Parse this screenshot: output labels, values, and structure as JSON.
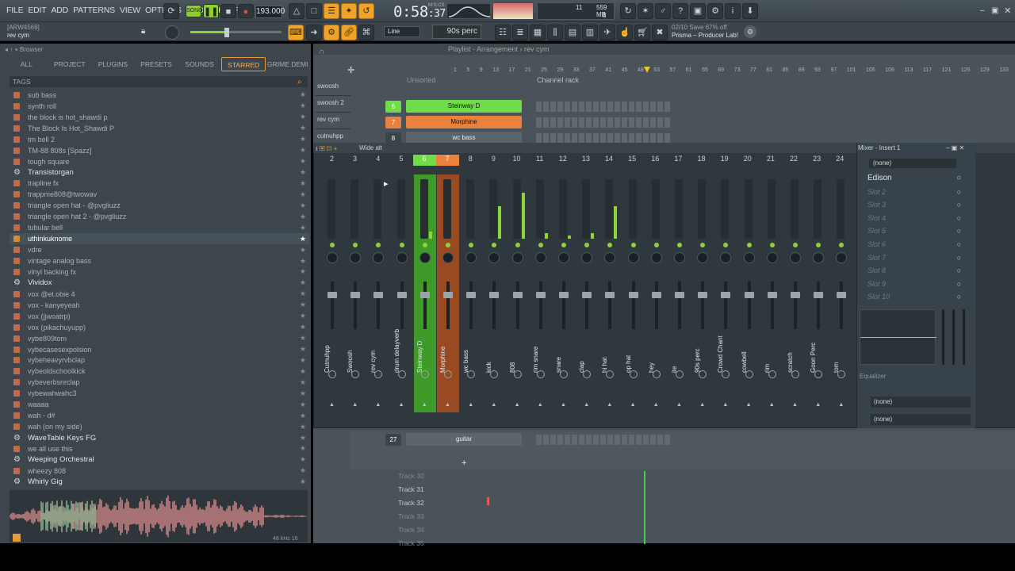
{
  "menu": [
    "FILE",
    "EDIT",
    "ADD",
    "PATTERNS",
    "VIEW",
    "OPTIONS",
    "TOOLS",
    "HELP"
  ],
  "transport": {
    "tempo": "193.000",
    "time_main": "0:58",
    "time_sub": ":37",
    "time_unit": "M:S:CS",
    "mode": "SONG",
    "cpu": "11",
    "mem": "559 MB",
    "voices": "8"
  },
  "hint": {
    "code": "[ARW4569]",
    "name": "rev cym"
  },
  "snap": {
    "value": "Line",
    "step": "90s perc"
  },
  "news": {
    "text": "02/10  Save 67% off",
    "sub": "Prisma – Producer Lab!"
  },
  "browser": {
    "title": "Browser",
    "tabs": [
      "ALL",
      "PROJECT",
      "PLUGINS",
      "PRESETS",
      "SOUNDS",
      "STARRED",
      "GRIME DEMI 0..."
    ],
    "active_tab": "STARRED",
    "tags_label": "TAGS",
    "items": [
      {
        "label": "sub bass",
        "type": "file"
      },
      {
        "label": "synth roll",
        "type": "file"
      },
      {
        "label": "the block is hot_shawdi p",
        "type": "file"
      },
      {
        "label": "The Block Is Hot_Shawdi P",
        "type": "file"
      },
      {
        "label": "tm bell 2",
        "type": "file"
      },
      {
        "label": "TM-88 808s [Spazz]",
        "type": "file"
      },
      {
        "label": "tough square",
        "type": "file"
      },
      {
        "label": "Transistorgan",
        "type": "plugin"
      },
      {
        "label": "trapline fx",
        "type": "file"
      },
      {
        "label": "trappme808@twowav",
        "type": "file"
      },
      {
        "label": "triangle open hat - @pvgliuzz",
        "type": "file"
      },
      {
        "label": "triangle open hat 2 - @pvgliuzz",
        "type": "file"
      },
      {
        "label": "tubular bell",
        "type": "file"
      },
      {
        "label": "uthinkuknome",
        "type": "folder",
        "selected": true
      },
      {
        "label": "vdre",
        "type": "file"
      },
      {
        "label": "vintage analog bass",
        "type": "file"
      },
      {
        "label": "vinyl backing fx",
        "type": "file"
      },
      {
        "label": "Vividox",
        "type": "plugin"
      },
      {
        "label": "vox @el.obie 4",
        "type": "file"
      },
      {
        "label": "vox - kanyeyeah",
        "type": "file"
      },
      {
        "label": "vox (jjwoatrp)",
        "type": "file"
      },
      {
        "label": "vox (pikachuyupp)",
        "type": "file"
      },
      {
        "label": "vybe809tom",
        "type": "file"
      },
      {
        "label": "vybecasesexpolsion",
        "type": "file"
      },
      {
        "label": "vybeheavyrvbclap",
        "type": "file"
      },
      {
        "label": "vybeoldschoolkick",
        "type": "file"
      },
      {
        "label": "vybeverbsnrclap",
        "type": "file"
      },
      {
        "label": "vybewahwahc3",
        "type": "file"
      },
      {
        "label": "waaaa",
        "type": "file"
      },
      {
        "label": "wah - d#",
        "type": "file"
      },
      {
        "label": "wah (on my side)",
        "type": "file"
      },
      {
        "label": "WaveTable Keys FG",
        "type": "plugin"
      },
      {
        "label": "we all use this",
        "type": "file"
      },
      {
        "label": "Weeping Orchestral",
        "type": "plugin"
      },
      {
        "label": "wheezy 808",
        "type": "file"
      },
      {
        "label": "Whirly Gig",
        "type": "plugin"
      }
    ],
    "wave_meta": "48 kHz 16"
  },
  "playlist": {
    "title": "Playlist - Arrangement",
    "pattern": "rev cym",
    "sort": "Unsorted",
    "rack_title": "Channel rack",
    "ruler": [
      "1",
      "5",
      "9",
      "13",
      "17",
      "21",
      "25",
      "29",
      "33",
      "37",
      "41",
      "45",
      "49",
      "53",
      "57",
      "61",
      "65",
      "69",
      "73",
      "77",
      "81",
      "85",
      "89",
      "93",
      "97",
      "101",
      "105",
      "109",
      "113",
      "117",
      "121",
      "125",
      "129",
      "133"
    ],
    "track_labels": [
      "swoosh",
      "swoosh 2",
      "rev cym",
      "cutnuhpp"
    ],
    "channels": [
      {
        "num": "6",
        "name": "Steinway D",
        "color": "#6fdc4a"
      },
      {
        "num": "7",
        "name": "Morphine",
        "color": "#e8823e"
      },
      {
        "num": "8",
        "name": "wc bass",
        "color": "#5a646a"
      }
    ],
    "lower_channel": {
      "num": "27",
      "name": "guitar"
    },
    "tracks": [
      {
        "label": "Track 30",
        "dim": true
      },
      {
        "label": "Track 31",
        "dim": false
      },
      {
        "label": "Track 32",
        "dim": false
      },
      {
        "label": "Track 33",
        "dim": true
      },
      {
        "label": "Track 34",
        "dim": true
      },
      {
        "label": "Track 35",
        "dim": true
      }
    ]
  },
  "mixer": {
    "title": "Wide alt",
    "insert_title": "Mixer - Insert 1",
    "inserts": [
      {
        "num": "2",
        "name": "Cutnuhpp",
        "level": 0
      },
      {
        "num": "3",
        "name": "Swoosh",
        "level": 0
      },
      {
        "num": "4",
        "name": "rev cym",
        "level": 0
      },
      {
        "num": "5",
        "name": "drum delayverb",
        "level": 0
      },
      {
        "num": "6",
        "name": "Steinway D",
        "level": 0.12,
        "color": "green"
      },
      {
        "num": "7",
        "name": "Morphine",
        "level": 0,
        "color": "orange"
      },
      {
        "num": "8",
        "name": "wc bass",
        "level": 0
      },
      {
        "num": "9",
        "name": "kick",
        "level": 0.55
      },
      {
        "num": "10",
        "name": "808",
        "level": 0.78
      },
      {
        "num": "11",
        "name": "rim snare",
        "level": 0.1
      },
      {
        "num": "12",
        "name": "snare",
        "level": 0.05
      },
      {
        "num": "13",
        "name": "clap",
        "level": 0.1
      },
      {
        "num": "14",
        "name": "hi hat",
        "level": 0.55
      },
      {
        "num": "15",
        "name": "op hat",
        "level": 0
      },
      {
        "num": "16",
        "name": "hey",
        "level": 0
      },
      {
        "num": "17",
        "name": "ite",
        "level": 0
      },
      {
        "num": "18",
        "name": "90s perc",
        "level": 0
      },
      {
        "num": "19",
        "name": "Crowd Chant",
        "level": 0
      },
      {
        "num": "20",
        "name": "cowbell",
        "level": 0
      },
      {
        "num": "21",
        "name": "rim",
        "level": 0
      },
      {
        "num": "22",
        "name": "scratch",
        "level": 0
      },
      {
        "num": "23",
        "name": "Goon Perc",
        "level": 0
      },
      {
        "num": "24",
        "name": "tom",
        "level": 0
      }
    ],
    "panel": {
      "preset": "(none)",
      "slots": [
        "Edison",
        "Slot 2",
        "Slot 3",
        "Slot 4",
        "Slot 5",
        "Slot 6",
        "Slot 7",
        "Slot 8",
        "Slot 9",
        "Slot 10"
      ],
      "eq_label": "Equalizer",
      "out1": "(none)",
      "out2": "(none)"
    }
  },
  "colors": {
    "accent": "#f0a32a",
    "green": "#6fdc4a",
    "orange": "#e8823e"
  }
}
